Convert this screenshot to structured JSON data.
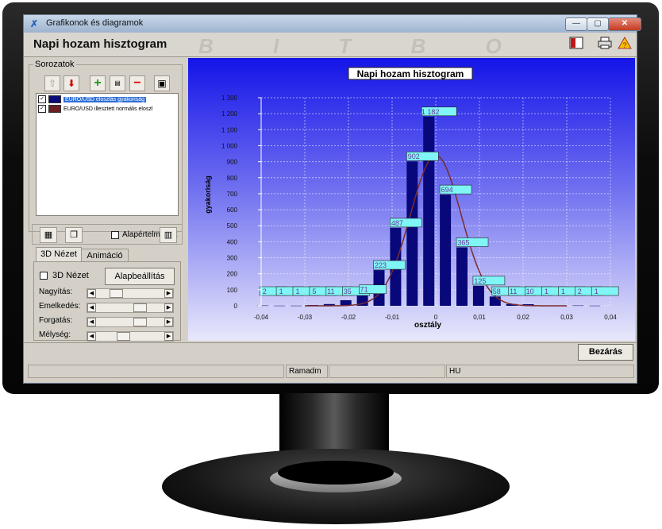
{
  "window": {
    "title": "Grafikonok és diagramok",
    "controls": {
      "minimize": "—",
      "maximize": "▢",
      "close": "✕"
    },
    "header_title": "Napi hozam hisztogram",
    "watermark": "B I T B O"
  },
  "series_panel": {
    "label": "Sorozatok",
    "toolbar_icons": [
      "arrow-up-icon",
      "arrow-down-icon",
      "add-icon",
      "edit-icon",
      "remove-icon",
      "save-icon"
    ],
    "items": [
      {
        "label": "EURO/USD eloszlás gyakoriság",
        "checked": true,
        "color": "#0a0a7a"
      },
      {
        "label": "EURO/USD illesztett normális eloszl",
        "checked": true,
        "color": "#6b1f24"
      }
    ],
    "default_label": "Alapértelmezett"
  },
  "tabs": [
    {
      "label": "3D Nézet",
      "active": true
    },
    {
      "label": "Animáció",
      "active": false
    }
  ],
  "view3d": {
    "checkbox_label": "3D Nézet",
    "reset_button": "Alapbeállítás",
    "sliders": [
      {
        "label": "Nagyítás:",
        "level": 0.25
      },
      {
        "label": "Emelkedés:",
        "level": 0.66
      },
      {
        "label": "Forgatás:",
        "level": 0.66
      },
      {
        "label": "Mélység:",
        "level": 0.33
      }
    ]
  },
  "chart_data": {
    "type": "bar",
    "title": "Napi hozam hisztogram",
    "xlabel": "osztály",
    "ylabel": "gyakoriság",
    "xlim": [
      -0.04,
      0.04
    ],
    "ylim": [
      0,
      1300
    ],
    "x_ticks": [
      "-0,04",
      "-0,03",
      "-0,02",
      "-0,01",
      "0",
      "0,01",
      "0,02",
      "0,03",
      "0,04"
    ],
    "y_ticks": [
      "0",
      "100",
      "200",
      "300",
      "400",
      "500",
      "600",
      "700",
      "800",
      "900",
      "1 000",
      "1 100",
      "1 200",
      "1 300"
    ],
    "grid": true,
    "bar_color": "#08087a",
    "curve_color": "#7a2c2c",
    "label_bg": "#7ff5f5",
    "bars": [
      {
        "x": -0.0396,
        "value": 2,
        "label": "2"
      },
      {
        "x": -0.0358,
        "value": 1,
        "label": "1"
      },
      {
        "x": -0.032,
        "value": 1,
        "label": "1"
      },
      {
        "x": -0.0282,
        "value": 5,
        "label": "5"
      },
      {
        "x": -0.0244,
        "value": 11,
        "label": "11"
      },
      {
        "x": -0.0206,
        "value": 35,
        "label": "35"
      },
      {
        "x": -0.0168,
        "value": 71,
        "label": "71"
      },
      {
        "x": -0.013,
        "value": 223,
        "label": "223"
      },
      {
        "x": -0.0092,
        "value": 487,
        "label": "487"
      },
      {
        "x": -0.0054,
        "value": 902,
        "label": "902"
      },
      {
        "x": -0.0016,
        "value": 1182,
        "label": "1 182"
      },
      {
        "x": 0.0022,
        "value": 694,
        "label": "694"
      },
      {
        "x": 0.006,
        "value": 365,
        "label": "365"
      },
      {
        "x": 0.0098,
        "value": 125,
        "label": "125"
      },
      {
        "x": 0.0136,
        "value": 58,
        "label": "58"
      },
      {
        "x": 0.0174,
        "value": 11,
        "label": "11"
      },
      {
        "x": 0.0212,
        "value": 10,
        "label": "10"
      },
      {
        "x": 0.025,
        "value": 1,
        "label": "1"
      },
      {
        "x": 0.0288,
        "value": 1,
        "label": "1"
      },
      {
        "x": 0.0326,
        "value": 2,
        "label": "2"
      },
      {
        "x": 0.0364,
        "value": 1,
        "label": "1"
      }
    ],
    "normal_fit": {
      "mean": 0.0,
      "sd": 0.0058,
      "peak": 940
    }
  },
  "buttons": {
    "close": "Bezárás"
  },
  "statusbar": [
    "",
    "Ramadm",
    "",
    "HU",
    ""
  ]
}
